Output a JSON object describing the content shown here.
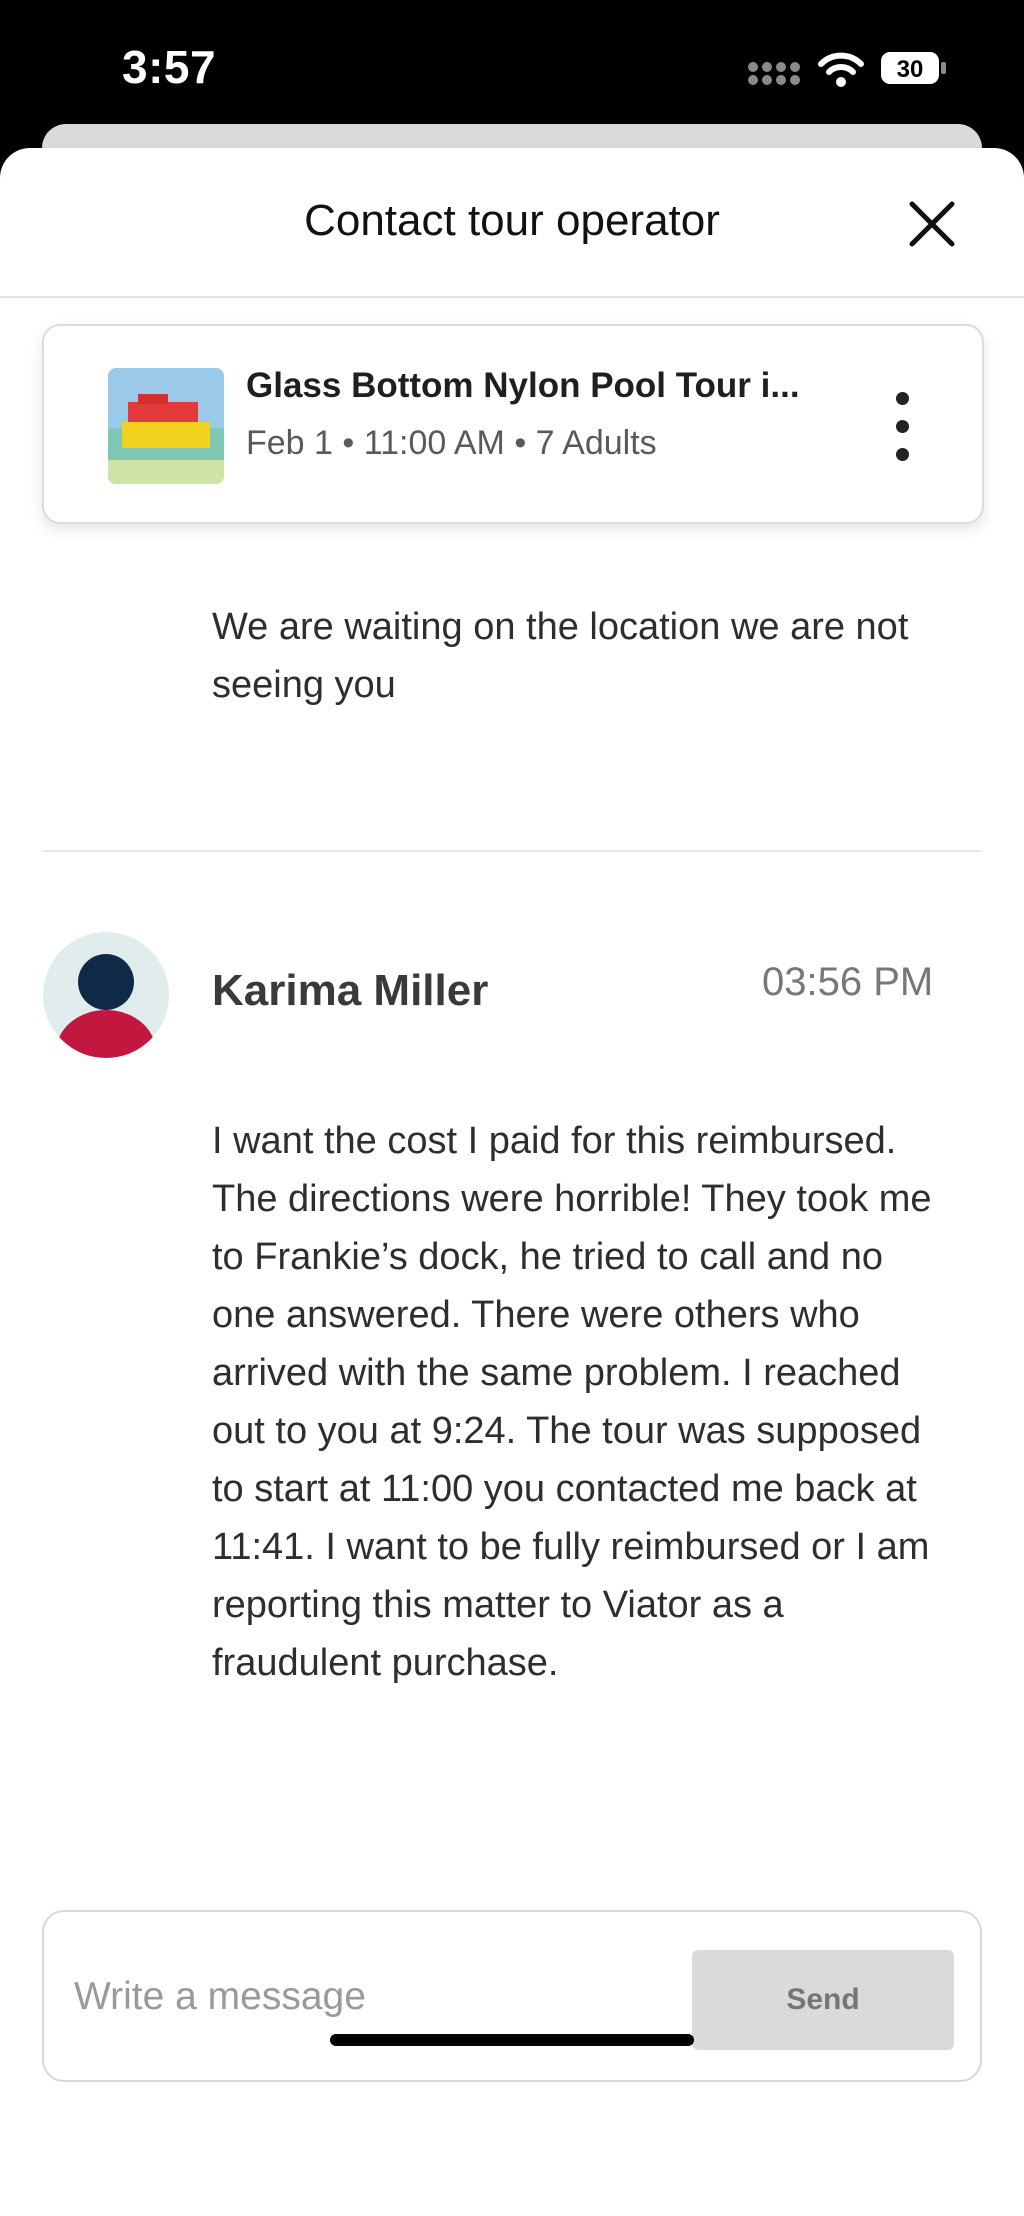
{
  "status_bar": {
    "time": "3:57",
    "battery": "30",
    "signal_icon": "cellular-signal-icon",
    "wifi_icon": "wifi-icon",
    "battery_icon": "battery-icon"
  },
  "header": {
    "title": "Contact tour operator",
    "close_icon": "close-icon"
  },
  "tour_card": {
    "title": "Glass Bottom Nylon Pool Tour i...",
    "meta": "Feb 1 • 11:00 AM • 7 Adults",
    "more_icon": "more-vertical-icon"
  },
  "messages": [
    {
      "text": "We are waiting on the location we are not seeing you"
    },
    {
      "sender": "Karima Miller",
      "time": "03:56 PM",
      "text": "I want the cost I paid for this reimbursed. The directions were horrible! They took me to Frankie’s dock, he tried to call and no one answered. There were others who arrived with the same problem. I reached out to you at 9:24. The tour was supposed to start at 11:00 you contacted me back at 11:41. I want to be fully reimbursed or I am reporting this matter to Viator as a fraudulent purchase."
    }
  ],
  "composer": {
    "placeholder": "Write a message",
    "value": "",
    "send_label": "Send"
  },
  "colors": {
    "accent_avatar_head": "#0f2a47",
    "accent_avatar_body": "#c2173f",
    "avatar_bg": "#e1eded",
    "send_disabled": "#dadada"
  }
}
